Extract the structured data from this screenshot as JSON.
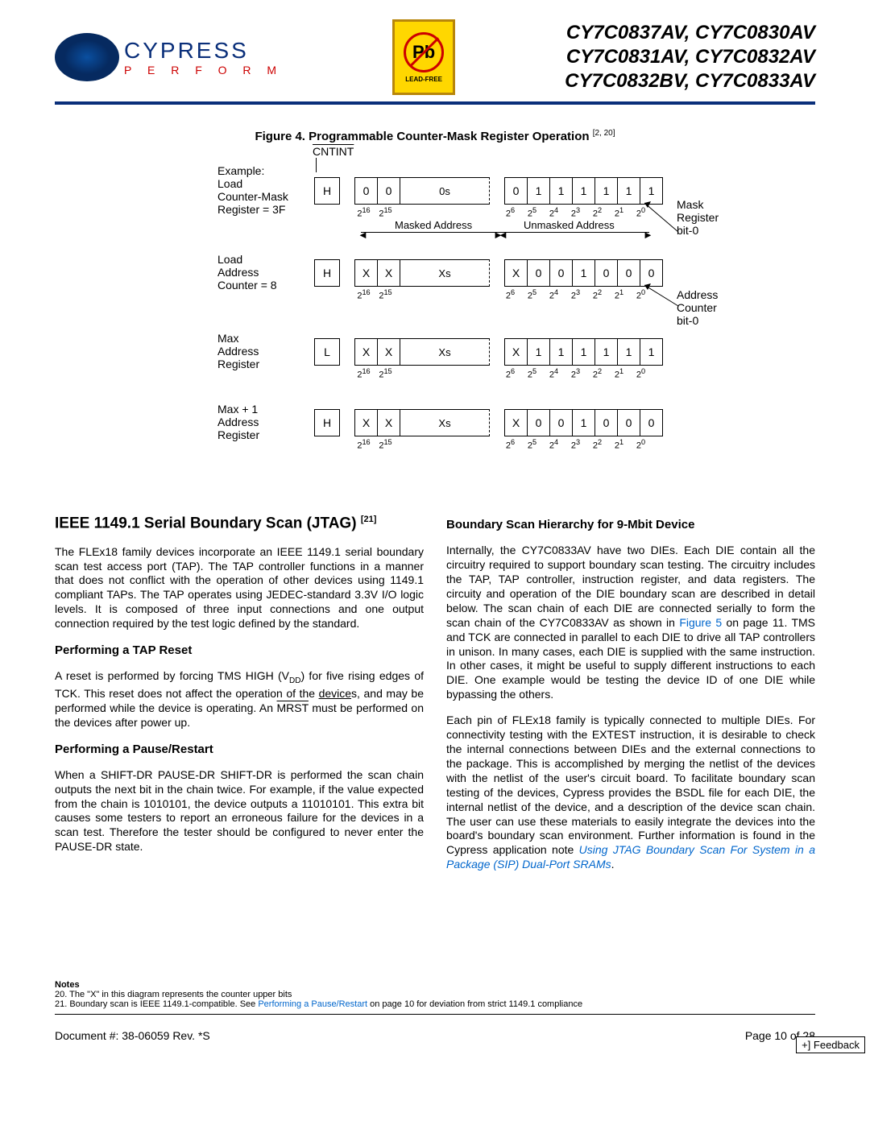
{
  "header": {
    "logo_name": "CYPRESS",
    "logo_sub": "P E R F O R M",
    "leadfree_symbol": "Pb",
    "leadfree_text": "LEAD-FREE",
    "parts": [
      "CY7C0837AV, CY7C0830AV",
      "CY7C0831AV, CY7C0832AV",
      "CY7C0832BV, CY7C0833AV"
    ]
  },
  "figure": {
    "title": "Figure 4.  Programmable Counter-Mask Register Operation",
    "refs": "[2, 20]",
    "cntint": "CNTINT",
    "example_label": "Example:\nLoad\nCounter-Mask\nRegister = 3F",
    "load_counter_label": "Load\nAddress\nCounter = 8",
    "max_label": "Max\nAddress\nRegister",
    "maxplus_label": "Max + 1\nAddress\nRegister",
    "mask_reg_label": "Mask\nRegister\nbit-0",
    "addr_counter_label": "Address\nCounter\nbit-0",
    "masked_addr": "Masked Address",
    "unmasked_addr": "Unmasked Address",
    "bit_powers_left": [
      "2^16",
      "2^15"
    ],
    "bit_powers_right": [
      "2^6",
      "2^5",
      "2^4",
      "2^3",
      "2^2",
      "2^1",
      "2^0"
    ],
    "rows": [
      {
        "h": "H",
        "b16": "0",
        "b15": "0",
        "mid": "0s",
        "low": [
          "0",
          "1",
          "1",
          "1",
          "1",
          "1",
          "1"
        ]
      },
      {
        "h": "H",
        "b16": "X",
        "b15": "X",
        "mid": "Xs",
        "low": [
          "X",
          "0",
          "0",
          "1",
          "0",
          "0",
          "0"
        ]
      },
      {
        "h": "L",
        "b16": "X",
        "b15": "X",
        "mid": "Xs",
        "low": [
          "X",
          "1",
          "1",
          "1",
          "1",
          "1",
          "1"
        ]
      },
      {
        "h": "H",
        "b16": "X",
        "b15": "X",
        "mid": "Xs",
        "low": [
          "X",
          "0",
          "0",
          "1",
          "0",
          "0",
          "0"
        ]
      }
    ]
  },
  "section_jtag": {
    "title": "IEEE 1149.1 Serial Boundary Scan (JTAG)",
    "ref": "[21]",
    "intro": "The FLEx18 family devices incorporate an IEEE 1149.1 serial boundary scan test access port (TAP). The TAP controller functions in a manner that does not conflict with the operation of other devices using 1149.1 compliant TAPs. The TAP operates using JEDEC-standard 3.3V I/O logic levels. It is composed of three input connections and one output connection required by the test logic defined by the standard.",
    "tap_reset": {
      "title": "Performing a TAP Reset",
      "text_a": "A reset is performed by forcing TMS HIGH (V",
      "text_b": ") for five rising edges of TCK. This reset does not affect the operation of the ",
      "text_c": "s, and may be performed while the device is operating. An ",
      "text_d": " must be performed on the devices after power up.",
      "vdd_sub": "DD",
      "device_under": "device",
      "mrst_over": "MRST"
    },
    "pause": {
      "title": "Performing a Pause/Restart",
      "text": "When a SHIFT-DR PAUSE-DR SHIFT-DR is performed the scan chain outputs the next bit in the chain twice. For example, if the value expected from the chain is 1010101, the device outputs a 11010101. This extra bit causes some testers to report an erroneous failure for the devices in a scan test. Therefore the tester should be configured to never enter the PAUSE-DR state."
    }
  },
  "section_hierarchy": {
    "title": "Boundary Scan Hierarchy for 9-Mbit Device",
    "p1_a": "Internally, the CY7C0833AV have two DIEs. Each DIE contain all the circuitry required to support boundary scan testing. The circuitry includes the TAP, TAP controller, instruction register, and data registers. The circuity and operation of the DIE boundary scan are described in detail below. The scan chain of each DIE are connected serially to form the scan chain of the CY7C0833AV as shown in ",
    "p1_link": "Figure 5",
    "p1_b": " on page 11. TMS and TCK are connected in parallel to each DIE to drive all TAP controllers in unison. In many cases, each DIE is supplied with the same instruction. In other cases, it might be useful to supply different instructions to each DIE. One example would be testing the device ID of one DIE while bypassing the others.",
    "p2_a": "Each pin of FLEx18 family is typically connected to multiple DIEs. For connectivity testing with the EXTEST instruction, it is desirable to check the internal connections between DIEs and the external connections to the package. This is accomplished by merging the netlist of the devices with the netlist of the user's circuit board. To facilitate boundary scan testing of the devices, Cypress provides the BSDL file for each DIE, the internal netlist of the device, and a description of the device scan chain. The user can use these materials to easily integrate the devices into the board's boundary scan environment. Further information is found in the Cypress application note ",
    "p2_link": "Using JTAG Boundary Scan For System in a Package (SIP) Dual-Port SRAMs",
    "p2_b": "."
  },
  "notes": {
    "title": "Notes",
    "n20": "20. The \"X\" in this diagram represents the counter upper bits",
    "n21_a": "21. Boundary scan is IEEE 1149.1-compatible. See ",
    "n21_link": "Performing a Pause/Restart",
    "n21_b": " on page 10 for deviation from strict 1149.1 compliance"
  },
  "footer": {
    "doc": "Document #: 38-06059 Rev. *S",
    "page": "Page 10 of 28",
    "feedback": "+] Feedback"
  }
}
